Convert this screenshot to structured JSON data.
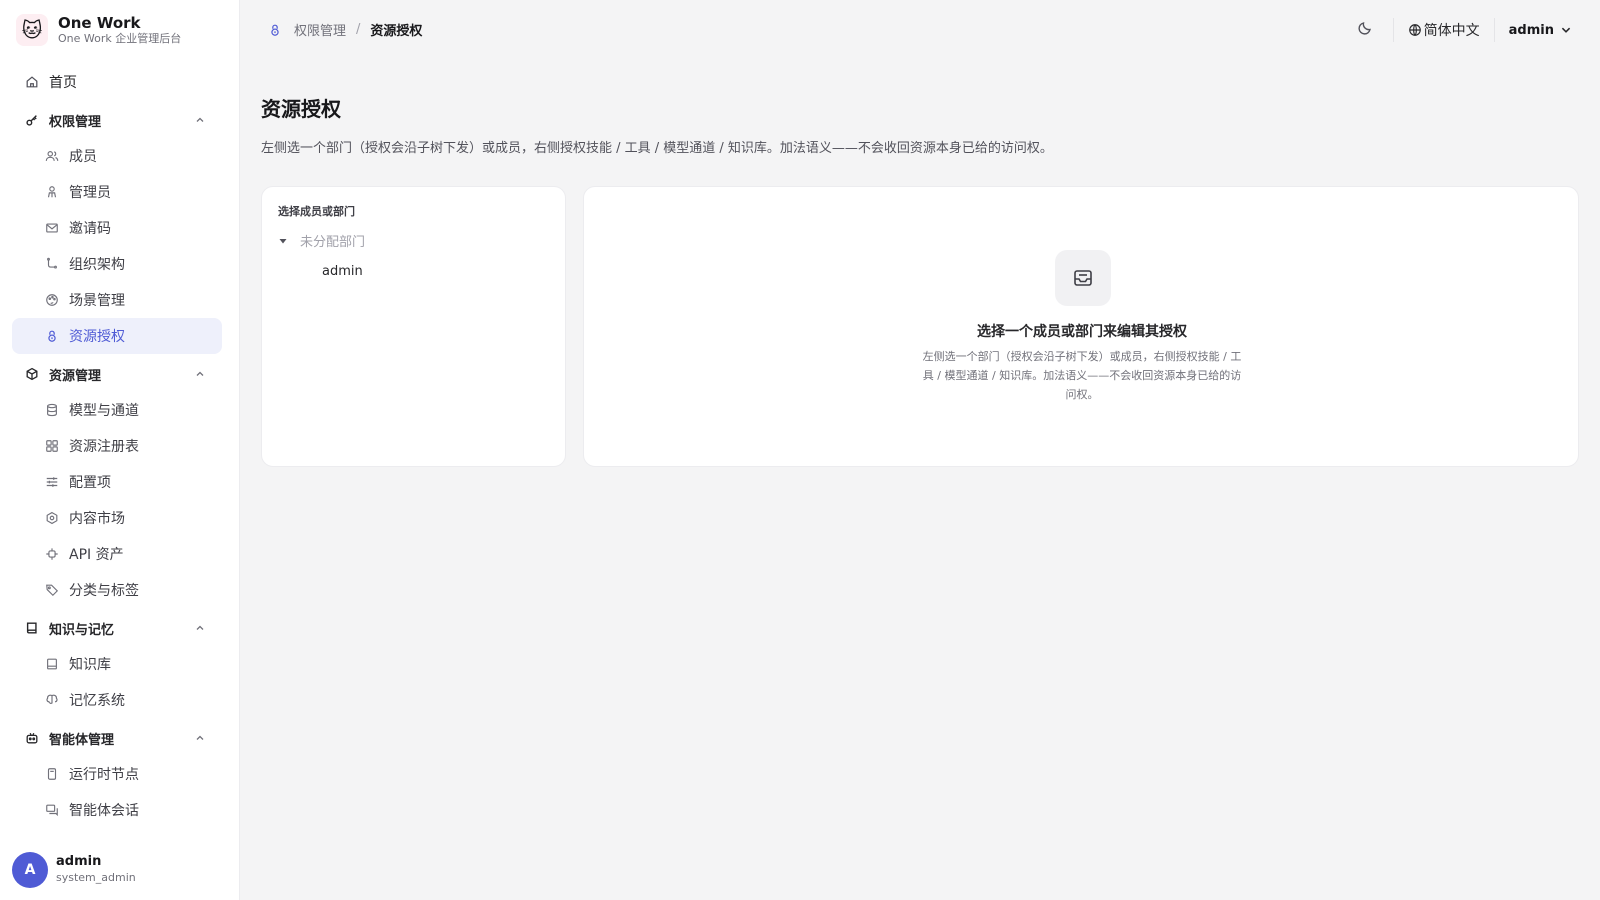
{
  "app": {
    "name": "One Work",
    "subtitle": "One Work 企业管理后台"
  },
  "sidebar": {
    "home": "首页",
    "groups": [
      {
        "label": "权限管理",
        "items": [
          "成员",
          "管理员",
          "邀请码",
          "组织架构",
          "场景管理",
          "资源授权"
        ]
      },
      {
        "label": "资源管理",
        "items": [
          "模型与通道",
          "资源注册表",
          "配置项",
          "内容市场",
          "API 资产",
          "分类与标签"
        ]
      },
      {
        "label": "知识与记忆",
        "items": [
          "知识库",
          "记忆系统"
        ]
      },
      {
        "label": "智能体管理",
        "items": [
          "运行时节点",
          "智能体会话"
        ]
      }
    ],
    "active_item": "资源授权"
  },
  "user": {
    "avatar_letter": "A",
    "name": "admin",
    "role": "system_admin"
  },
  "topbar": {
    "breadcrumb_parent": "权限管理",
    "breadcrumb_sep": "/",
    "breadcrumb_current": "资源授权",
    "language": "简体中文",
    "account": "admin"
  },
  "page": {
    "title": "资源授权",
    "description": "左侧选一个部门（授权会沿子树下发）或成员，右侧授权技能 / 工具 / 模型通道 / 知识库。加法语义——不会收回资源本身已给的访问权。"
  },
  "selector": {
    "label": "选择成员或部门",
    "department": "未分配部门",
    "member": "admin"
  },
  "empty_state": {
    "title": "选择一个成员或部门来编辑其授权",
    "description": "左侧选一个部门（授权会沿子树下发）或成员，右侧授权技能 / 工具 / 模型通道 / 知识库。加法语义——不会收回资源本身已给的访问权。"
  },
  "colors": {
    "accent": "#4f5bd5",
    "active_bg": "#eef0fb",
    "page_bg": "#f4f4f5"
  }
}
